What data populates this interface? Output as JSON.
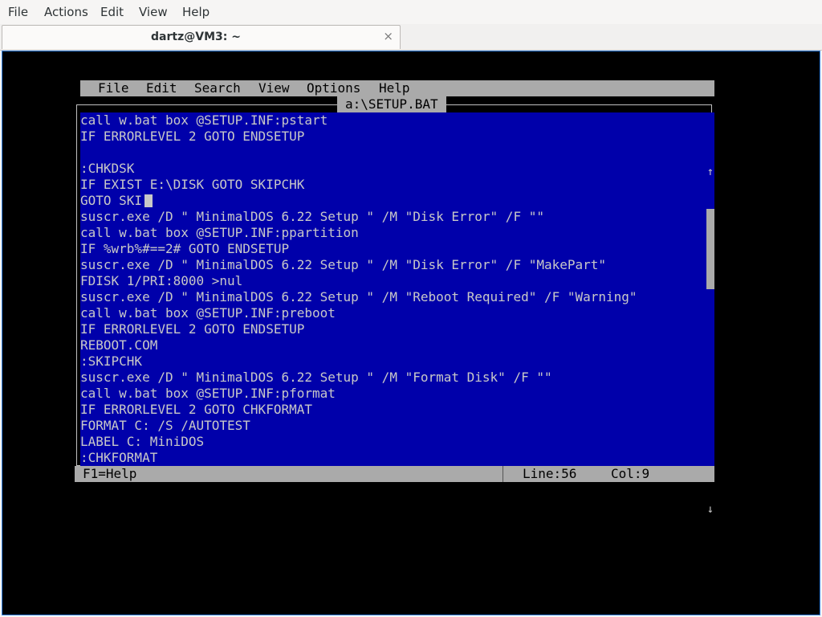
{
  "app_menu": [
    "File",
    "Actions",
    "Edit",
    "View",
    "Help"
  ],
  "tab": {
    "title": "dartz@VM3: ~",
    "close_icon": "×"
  },
  "dos": {
    "menu": [
      "File",
      "Edit",
      "Search",
      "View",
      "Options",
      "Help"
    ],
    "filename": "a:\\SETUP.BAT",
    "lines": [
      "call w.bat box @SETUP.INF:pstart",
      "IF ERRORLEVEL 2 GOTO ENDSETUP",
      "",
      ":CHKDSK",
      "IF EXIST E:\\DISK GOTO SKIPCHK",
      "GOTO SKI",
      "suscr.exe /D \" MinimalDOS 6.22 Setup \" /M \"Disk Error\" /F \"\"",
      "call w.bat box @SETUP.INF:ppartition",
      "IF %wrb%#==2# GOTO ENDSETUP",
      "suscr.exe /D \" MinimalDOS 6.22 Setup \" /M \"Disk Error\" /F \"MakePart\"",
      "FDISK 1/PRI:8000 >nul",
      "suscr.exe /D \" MinimalDOS 6.22 Setup \" /M \"Reboot Required\" /F \"Warning\"",
      "call w.bat box @SETUP.INF:preboot",
      "IF ERRORLEVEL 2 GOTO ENDSETUP",
      "REBOOT.COM",
      ":SKIPCHK",
      "suscr.exe /D \" MinimalDOS 6.22 Setup \" /M \"Format Disk\" /F \"\"",
      "call w.bat box @SETUP.INF:pformat",
      "IF ERRORLEVEL 2 GOTO CHKFORMAT",
      "FORMAT C: /S /AUTOTEST",
      "LABEL C: MiniDOS",
      ":CHKFORMAT"
    ],
    "scroll_up": "↑",
    "scroll_down": "↓",
    "status": {
      "help": "F1=Help",
      "line": "Line:56",
      "col": "Col:9"
    },
    "colors": {
      "editor_bg": "#0000aa",
      "text": "#c8c8c8",
      "bars": "#aaaaaa"
    }
  }
}
